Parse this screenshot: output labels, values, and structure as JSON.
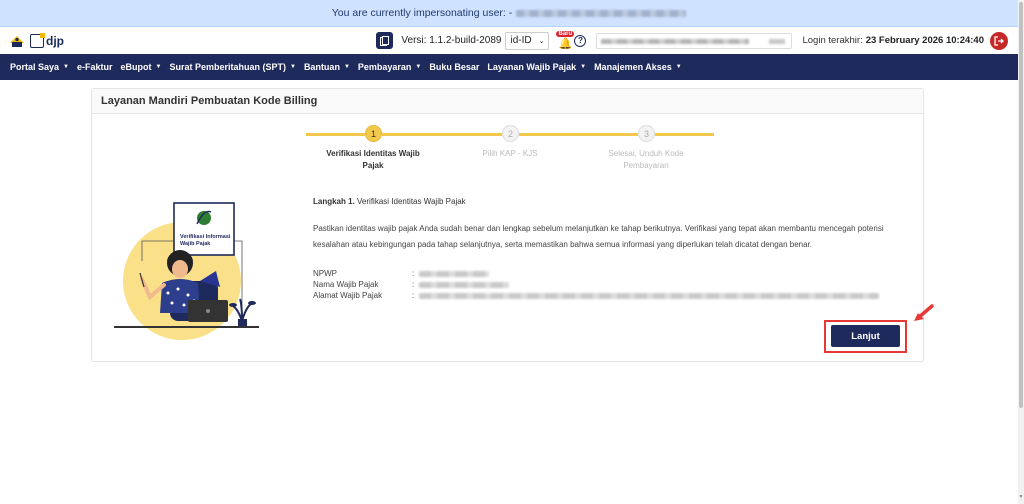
{
  "banner": {
    "text": "You are currently impersonating user: -"
  },
  "header": {
    "logo_text": "djp",
    "version_label": "Versi:  1.1.2-build-2089",
    "language": "id-ID",
    "new_badge": "Baru",
    "login_label": "Login terakhir:",
    "login_date": "23 February 2026 10:24:40"
  },
  "nav": {
    "items": [
      {
        "label": "Portal Saya",
        "dropdown": true
      },
      {
        "label": "e-Faktur",
        "dropdown": false
      },
      {
        "label": "eBupot",
        "dropdown": true
      },
      {
        "label": "Surat Pemberitahuan (SPT)",
        "dropdown": true
      },
      {
        "label": "Bantuan",
        "dropdown": true
      },
      {
        "label": "Pembayaran",
        "dropdown": true
      },
      {
        "label": "Buku Besar",
        "dropdown": false
      },
      {
        "label": "Layanan Wajib Pajak",
        "dropdown": true
      },
      {
        "label": "Manajemen Akses",
        "dropdown": true
      }
    ]
  },
  "card": {
    "title": "Layanan Mandiri Pembuatan Kode Billing"
  },
  "stepper": {
    "steps": [
      {
        "number": "1",
        "label": "Verifikasi Identitas Wajib Pajak",
        "active": true
      },
      {
        "number": "2",
        "label": "Pilih KAP - KJS",
        "active": false
      },
      {
        "number": "3",
        "label": "Selesai, Unduh Kode Pembayaran",
        "active": false
      }
    ]
  },
  "illustration": {
    "caption": "Verifikasi Informasi Wajib Pajak"
  },
  "content": {
    "step_prefix": "Langkah 1.",
    "step_title": "Verifikasi Identitas Wajib Pajak",
    "description": "Pastikan identitas wajib pajak Anda sudah benar dan lengkap sebelum melanjutkan ke tahap berikutnya. Verifikasi yang tepat akan membantu mencegah potensi kesalahan atau kebingungan pada tahap selanjutnya, serta memastikan bahwa semua informasi yang diperlukan telah dicatat dengan benar.",
    "fields": [
      {
        "label": "NPWP",
        "colon": ":"
      },
      {
        "label": "Nama Wajib Pajak",
        "colon": ":"
      },
      {
        "label": "Alamat Wajib Pajak",
        "colon": ":"
      }
    ]
  },
  "actions": {
    "next_label": "Lanjut"
  },
  "colors": {
    "navy": "#1f2a5c",
    "accent_yellow": "#f2c94c",
    "highlight_red": "#e53935"
  }
}
